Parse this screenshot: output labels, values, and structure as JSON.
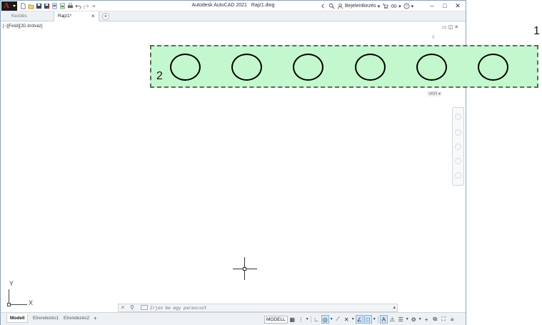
{
  "titlebar": {
    "app_title": "Autodesk AutoCAD 2021",
    "file_name": "Rajz1.dwg",
    "app_logo_letter": "A",
    "signin_label": "Bejelentkezés",
    "qat_icons": [
      "new-icon",
      "open-icon",
      "save-icon",
      "saveas-icon",
      "open-web-icon",
      "save-web-icon",
      "print-icon",
      "undo-icon",
      "redo-icon",
      "customize-icon"
    ]
  },
  "tabs": {
    "start_label": "Kezdés",
    "doc_label": "Rajz1*",
    "close_symbol": "×",
    "add_symbol": "+"
  },
  "viewport": {
    "view_label": "[−][Felül][2D drótváz]",
    "wcs_label": "VKR"
  },
  "annotations": {
    "callout_1": "1",
    "callout_2": "2",
    "band_color": "#c3f7cd",
    "circle_count": 6
  },
  "ucs": {
    "x_label": "X",
    "y_label": "Y"
  },
  "commandline": {
    "placeholder": "Írjon be egy parancsot",
    "close_symbol": "×",
    "settings_symbol": "⚙"
  },
  "statusbar": {
    "layouts": [
      "Modell",
      "Elrendezés1",
      "Elrendezés2"
    ],
    "add_layout_symbol": "+",
    "model_button": "MODELL"
  }
}
